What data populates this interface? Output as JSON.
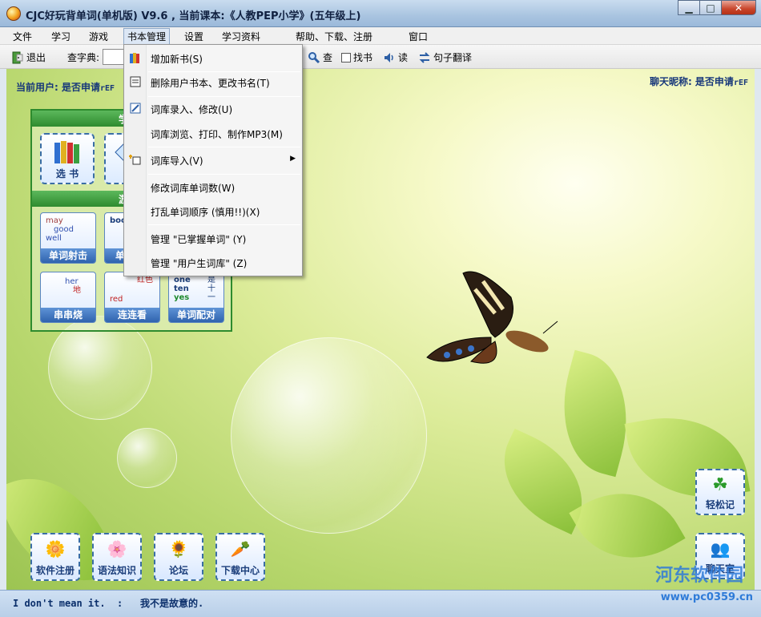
{
  "window": {
    "title": "CJC好玩背单词(单机版) V9.6 , 当前课本:《人教PEP小学》(五年级上)",
    "controls": {
      "minimize": "▁",
      "maximize": "□",
      "close": "✕"
    }
  },
  "menubar": {
    "items": [
      "文件",
      "学习",
      "游戏",
      "书本管理",
      "设置",
      "学习资料",
      "帮助、下载、注册",
      "窗口"
    ],
    "active": "书本管理"
  },
  "toolbar": {
    "exit": "退出",
    "lookup_label": "查字典:",
    "lookup_value": "",
    "search": "查",
    "find_book": "找书",
    "read": "读",
    "sentence_translate": "句子翻译"
  },
  "user": {
    "current_user": "当前用户: 是否申请",
    "current_user_suffix": "rEF",
    "chat_nickname": "聊天昵称: 是否申请",
    "chat_nickname_suffix": "rEF"
  },
  "panel": {
    "header_partial": "学",
    "header2_partial": "游",
    "big_buttons": [
      {
        "label": "选 书",
        "icon": "books-icon"
      },
      {
        "label": "学",
        "icon": "study-icon"
      }
    ],
    "games": [
      {
        "label": "单词射击",
        "art": [
          "may",
          "good",
          "well"
        ]
      },
      {
        "label": "单",
        "art": [
          "boo"
        ]
      },
      {
        "label": "串串烧",
        "art": [
          "her",
          "地"
        ]
      },
      {
        "label": "连连看",
        "art": [
          "红色",
          "red"
        ]
      },
      {
        "label": "单词配对",
        "art": [
          "one",
          "ten",
          "yes",
          "是",
          "十",
          "一"
        ]
      }
    ]
  },
  "dropdown": {
    "items": [
      {
        "label": "增加新书(S)",
        "icon": "books-icon"
      },
      {
        "label": "删除用户书本、更改书名(T)",
        "icon": "book-edit-icon"
      },
      {
        "label": "词库录入、修改(U)",
        "icon": "edit-icon"
      },
      {
        "label": "词库浏览、打印、制作MP3(M)",
        "icon": ""
      },
      {
        "label": "词库导入(V)",
        "icon": "import-icon",
        "submenu": true
      },
      {
        "label": "修改词库单词数(W)",
        "icon": ""
      },
      {
        "label": "打乱单词顺序    (慎用!!)(X)",
        "icon": ""
      },
      {
        "label": "管理 \"已掌握单词\" (Y)",
        "icon": ""
      },
      {
        "label": "管理 \"用户生词库\" (Z)",
        "icon": ""
      }
    ]
  },
  "bottom_buttons": [
    {
      "label": "软件注册",
      "icon": "flower-icon"
    },
    {
      "label": "语法知识",
      "icon": "flowers-icon"
    },
    {
      "label": "论坛",
      "icon": "sunflower-icon"
    },
    {
      "label": "下载中心",
      "icon": "download-icon"
    }
  ],
  "right_buttons": [
    {
      "label": "轻松记",
      "icon": "clover-icon"
    },
    {
      "label": "聊天室",
      "icon": "chat-people-icon"
    }
  ],
  "status": {
    "sentence": "I don't mean it.  :   我不是故意的."
  },
  "watermark": {
    "main": "河东软件园",
    "url": "www.pc0359.cn"
  }
}
